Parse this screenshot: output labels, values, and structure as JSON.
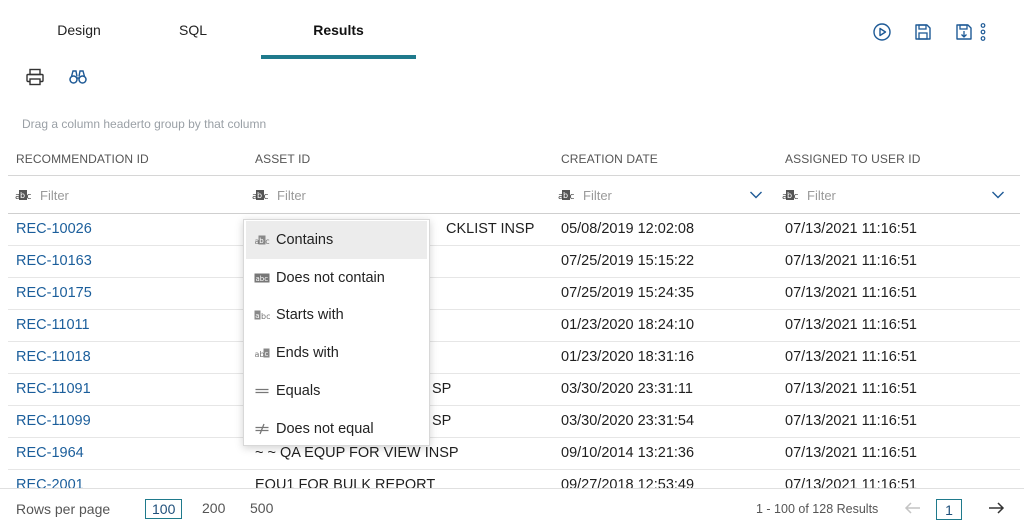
{
  "tabs": {
    "design": "Design",
    "sql": "SQL",
    "results": "Results"
  },
  "top_icons": [
    "run-icon",
    "save-icon",
    "save-as-icon",
    "more-icon"
  ],
  "toolbar_icons": [
    "print-icon",
    "find-icon"
  ],
  "group_hint": "Drag a column headerto group by that column",
  "columns": [
    "RECOMMENDATION ID",
    "ASSET ID",
    "CREATION DATE",
    "ASSIGNED TO USER ID"
  ],
  "filter_placeholder": "Filter",
  "rows": [
    {
      "id": "REC-10026",
      "asset": "CKLIST INSP",
      "created": "05/08/2019 12:02:08",
      "assigned": "07/13/2021 11:16:51"
    },
    {
      "id": "REC-10163",
      "asset": "",
      "created": "07/25/2019 15:15:22",
      "assigned": "07/13/2021 11:16:51"
    },
    {
      "id": "REC-10175",
      "asset": "",
      "created": "07/25/2019 15:24:35",
      "assigned": "07/13/2021 11:16:51"
    },
    {
      "id": "REC-11011",
      "asset": "",
      "created": "01/23/2020 18:24:10",
      "assigned": "07/13/2021 11:16:51"
    },
    {
      "id": "REC-11018",
      "asset": "",
      "created": "01/23/2020 18:31:16",
      "assigned": "07/13/2021 11:16:51"
    },
    {
      "id": "REC-11091",
      "asset": "SP",
      "created": "03/30/2020 23:31:11",
      "assigned": "07/13/2021 11:16:51"
    },
    {
      "id": "REC-11099",
      "asset": "SP",
      "created": "03/30/2020 23:31:54",
      "assigned": "07/13/2021 11:16:51"
    },
    {
      "id": "REC-1964",
      "asset": "~ ~ QA EQUP FOR VIEW INSP",
      "created": "09/10/2014 13:21:36",
      "assigned": "07/13/2021 11:16:51"
    },
    {
      "id": "REC-2001",
      "asset": "EQU1 FOR BULK REPORT",
      "created": "09/27/2018 12:53:49",
      "assigned": "07/13/2021 11:16:51"
    }
  ],
  "filter_menu": [
    "Contains",
    "Does not contain",
    "Starts with",
    "Ends with",
    "Equals",
    "Does not equal"
  ],
  "footer": {
    "rows_per_page_label": "Rows per page",
    "rpp_options": [
      "100",
      "200",
      "500"
    ],
    "results_count": "1 - 100 of 128 Results",
    "page": "1"
  },
  "colors": {
    "accent": "#1f7a8c",
    "link": "#1b5e9b",
    "icon": "#1e5a96"
  }
}
